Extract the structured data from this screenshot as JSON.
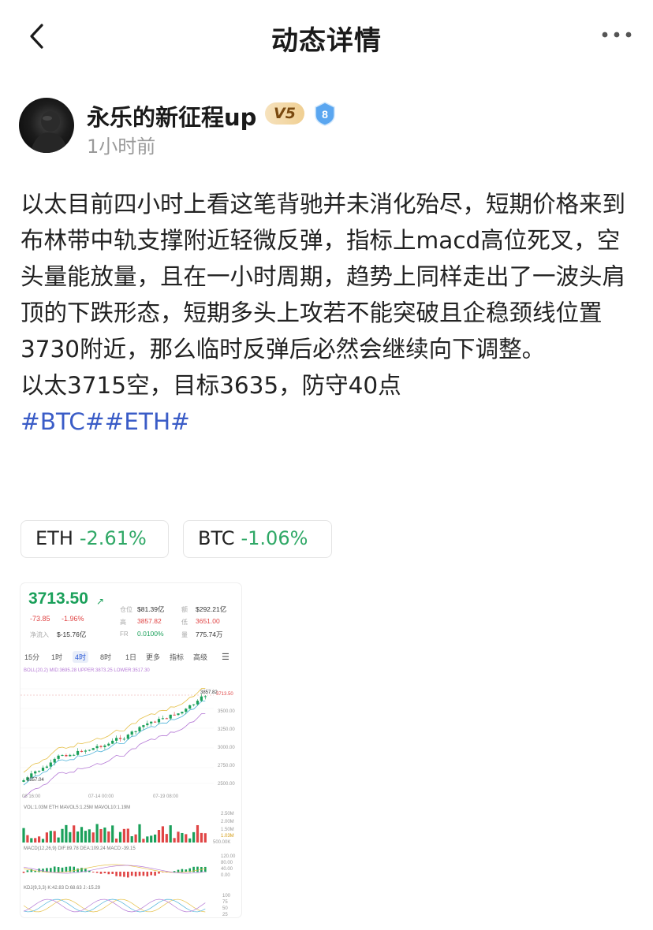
{
  "nav": {
    "title": "动态详情"
  },
  "author": {
    "name": "永乐的新征程up",
    "vip": "V5",
    "level": "8",
    "time": "1小时前"
  },
  "post": {
    "paragraph": "以太目前四小时上看这笔背驰并未消化殆尽，短期价格来到布林带中轨支撑附近轻微反弹，指标上macd高位死叉，空头量能放量，且在一小时周期，趋势上同样走出了一波头肩顶的下跌形态，短期多头上攻若不能突破且企稳颈线位置3730附近，那么临时反弹后必然会继续向下调整。",
    "trade": "以太3715空，目标3635，防守40点",
    "tags": "#BTC##ETH#"
  },
  "tickers": [
    {
      "symbol": "ETH",
      "change": "-2.61%"
    },
    {
      "symbol": "BTC",
      "change": "-1.06%"
    }
  ],
  "chart_card": {
    "price": "3713.50",
    "change_abs": "-73.85",
    "change_pct": "-1.96%",
    "net_inflow_label": "净流入",
    "net_inflow": "$-15.76亿",
    "stats": [
      {
        "label": "仓位",
        "value": "$81.39亿",
        "tone": "dark"
      },
      {
        "label": "额",
        "value": "$292.21亿",
        "tone": "dark"
      },
      {
        "label": "高",
        "value": "3857.82",
        "tone": "red"
      },
      {
        "label": "低",
        "value": "3651.00",
        "tone": "red"
      },
      {
        "label": "FR",
        "value": "0.0100%",
        "tone": "green"
      },
      {
        "label": "量",
        "value": "775.74万",
        "tone": "dark"
      }
    ],
    "timeframes": [
      "15分",
      "1时",
      "4时",
      "8时",
      "1日",
      "更多",
      "指标",
      "高级"
    ],
    "active_timeframe": "4时",
    "boll_legend": "BOLL(20,2) MID:3695.28 UPPER:3873.25 LOWER:3517.30",
    "price_axis": [
      "3857.82",
      "3713.50",
      "3500.00",
      "3250.00",
      "3000.00",
      "2750.00",
      "2500.00"
    ],
    "low_marker": "2557.04",
    "date_axis": [
      "08 16:00",
      "07-14 00:00",
      "07-19 08:00"
    ],
    "vol_legend": "VOL:1.03M ETH MAVOL5:1.25M MAVOL10:1.19M",
    "vol_axis": [
      "2.50M",
      "2.00M",
      "1.50M",
      "1.03M",
      "500.00K"
    ],
    "macd_legend": "MACD(12,26,9) DIF:89.78 DEA:109.24 MACD:-39.15",
    "macd_axis": [
      "120.00",
      "80.00",
      "40.00",
      "0.00"
    ],
    "kdj_legend": "KDJ(9,3,3) K:42.83 D:68.63 J:-15.29",
    "kdj_axis": [
      "100",
      "75",
      "50",
      "25"
    ]
  }
}
